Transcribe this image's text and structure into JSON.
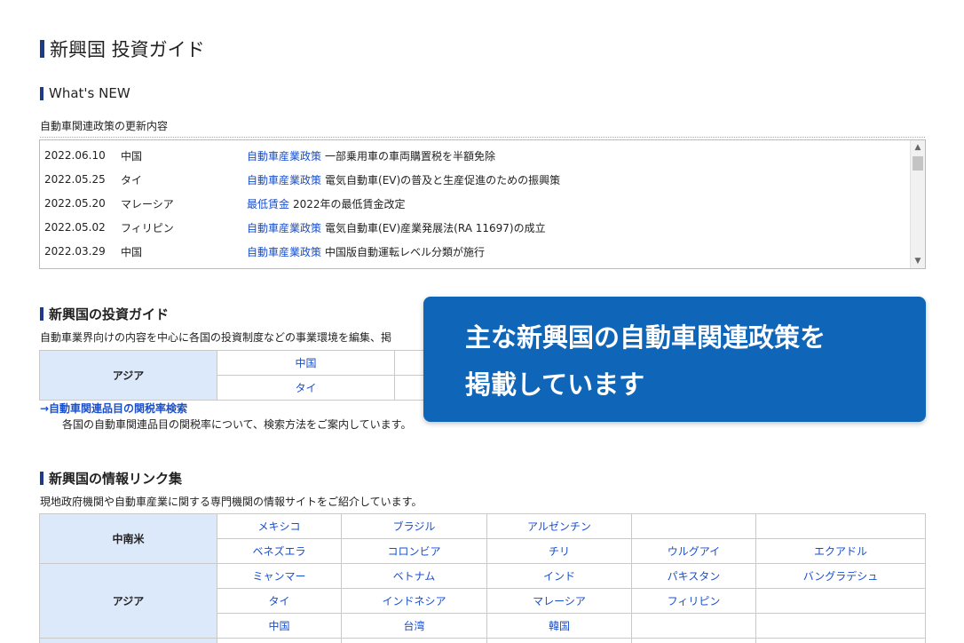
{
  "page": {
    "title": "新興国 投資ガイド"
  },
  "whats_new": {
    "heading": "What's NEW",
    "subheading": "自動車関連政策の更新内容",
    "items": [
      {
        "date": "2022.06.10",
        "country": "中国",
        "category": "自動車産業政策",
        "text": "一部乗用車の車両購置税を半額免除"
      },
      {
        "date": "2022.05.25",
        "country": "タイ",
        "category": "自動車産業政策",
        "text": "電気自動車(EV)の普及と生産促進のための振興策"
      },
      {
        "date": "2022.05.20",
        "country": "マレーシア",
        "category": "最低賃金",
        "text": "2022年の最低賃金改定"
      },
      {
        "date": "2022.05.02",
        "country": "フィリピン",
        "category": "自動車産業政策",
        "text": "電気自動車(EV)産業発展法(RA 11697)の成立"
      },
      {
        "date": "2022.03.29",
        "country": "中国",
        "category": "自動車産業政策",
        "text": "中国版自動運転レベル分類が施行"
      }
    ]
  },
  "investment_guide": {
    "heading": "新興国の投資ガイド",
    "description": "自動車業界向けの内容を中心に各国の投資制度などの事業環境を編集、掲",
    "region": "アジア",
    "countries": [
      "中国",
      "タイ"
    ],
    "tariff_link": "→自動車関連品目の関税率検索",
    "tariff_desc": "各国の自動車関連品目の関税率について、検索方法をご案内しています。"
  },
  "info_links": {
    "heading": "新興国の情報リンク集",
    "description": "現地政府機関や自動車産業に関する専門機関の情報サイトをご紹介しています。",
    "regions": [
      {
        "name": "中南米",
        "rows": [
          [
            "メキシコ",
            "ブラジル",
            "アルゼンチン",
            "",
            ""
          ],
          [
            "ベネズエラ",
            "コロンビア",
            "チリ",
            "ウルグアイ",
            "エクアドル"
          ]
        ]
      },
      {
        "name": "アジア",
        "rows": [
          [
            "ミャンマー",
            "ベトナム",
            "インド",
            "パキスタン",
            "バングラデシュ"
          ],
          [
            "タイ",
            "インドネシア",
            "マレーシア",
            "フィリピン",
            ""
          ],
          [
            "中国",
            "台湾",
            "韓国",
            "",
            ""
          ]
        ]
      }
    ]
  },
  "overlay": {
    "line1": "主な新興国の自動車関連政策を",
    "line2": "掲載しています"
  },
  "colors": {
    "accent": "#1d3b8a",
    "link": "#1a4fcc",
    "region_bg": "#dce9fb",
    "overlay_bg": "#0f66b8"
  }
}
